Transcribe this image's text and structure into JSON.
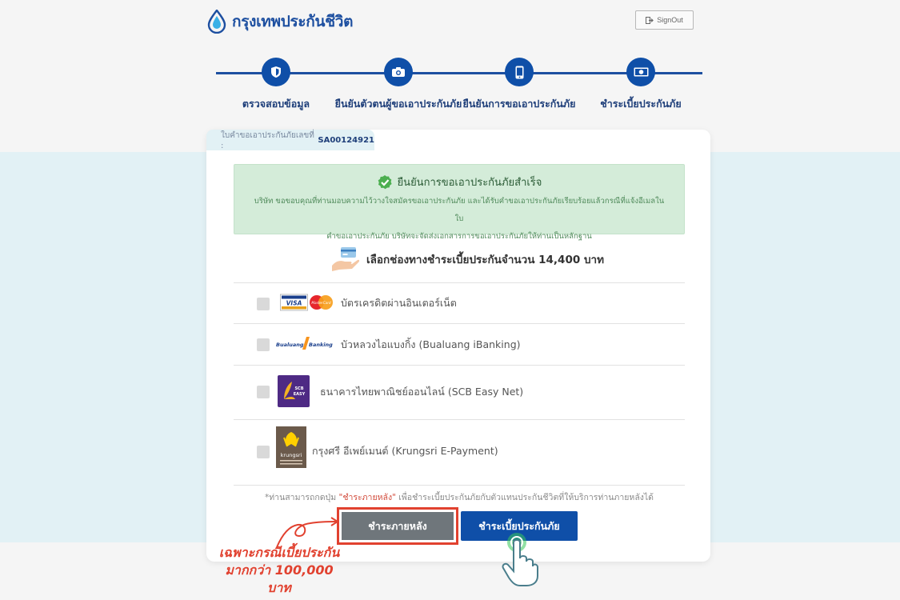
{
  "header": {
    "brand": "กรุงเทพประกันชีวิต",
    "signout_label": "SignOut"
  },
  "steps": [
    {
      "label": "ตรวจสอบข้อมูล",
      "icon": "shield-icon"
    },
    {
      "label": "ยืนยันตัวตนผู้ขอเอาประกันภัย",
      "icon": "camera-icon"
    },
    {
      "label": "ยืนยันการขอเอาประกันภัย",
      "icon": "phone-icon"
    },
    {
      "label": "ชำระเบี้ยประกันภัย",
      "icon": "money-icon"
    }
  ],
  "application": {
    "label": "ใบคำขอเอาประกันภัยเลขที่ :",
    "number": "SA00124921"
  },
  "success": {
    "title": "ยืนยันการขอเอาประกันภัยสำเร็จ",
    "line1": "บริษัท ขอขอบคุณที่ท่านมอบความไว้วางใจสมัครขอเอาประกันภัย และได้รับคำขอเอาประกันภัยเรียบร้อยแล้วกรณีที่แจ้งอีเมลในใบ",
    "line2": "คำขอเอาประกันภัย บริษัทจะจัดส่งเอกสารการขอเอาประกันภัยให้ท่านเป็นหลักฐาน"
  },
  "payment": {
    "heading": "เลือกช่องทางชำระเบี้ยประกันจำนวน 14,400 บาท",
    "options": [
      {
        "label": "บัตรเครดิตผ่านอินเตอร์เน็ต",
        "logo": "VISA"
      },
      {
        "label": "บัวหลวงไอแบงกิ้ง (Bualuang iBanking)",
        "logo": "Bualuang iBanking"
      },
      {
        "label": "ธนาคารไทยพาณิชย์ออนไลน์ (SCB Easy Net)",
        "logo": "SCB EASY"
      },
      {
        "label": "กรุงศรี อีเพย์เมนต์ (Krungsri E-Payment)",
        "logo": "krungsri"
      }
    ]
  },
  "note": {
    "pre": "*ท่านสามารถกดปุ่ม",
    "quoted": "\"ชำระภายหลัง\"",
    "post": "เพื่อชำระเบี้ยประกันภัยกับตัวแทนประกันชีวิตที่ให้บริการท่านภายหลังได้"
  },
  "buttons": {
    "pay_later": "ชำระภายหลัง",
    "pay_now": "ชำระเบี้ยประกันภัย"
  },
  "annotation": {
    "line1": "เฉพาะกรณีเบี้ยประกัน",
    "line2": "มากกว่า 100,000 บาท"
  },
  "colors": {
    "brand_blue": "#0f4fa8",
    "success_bg": "#d4ecd9",
    "annotation_red": "#e1412f"
  }
}
